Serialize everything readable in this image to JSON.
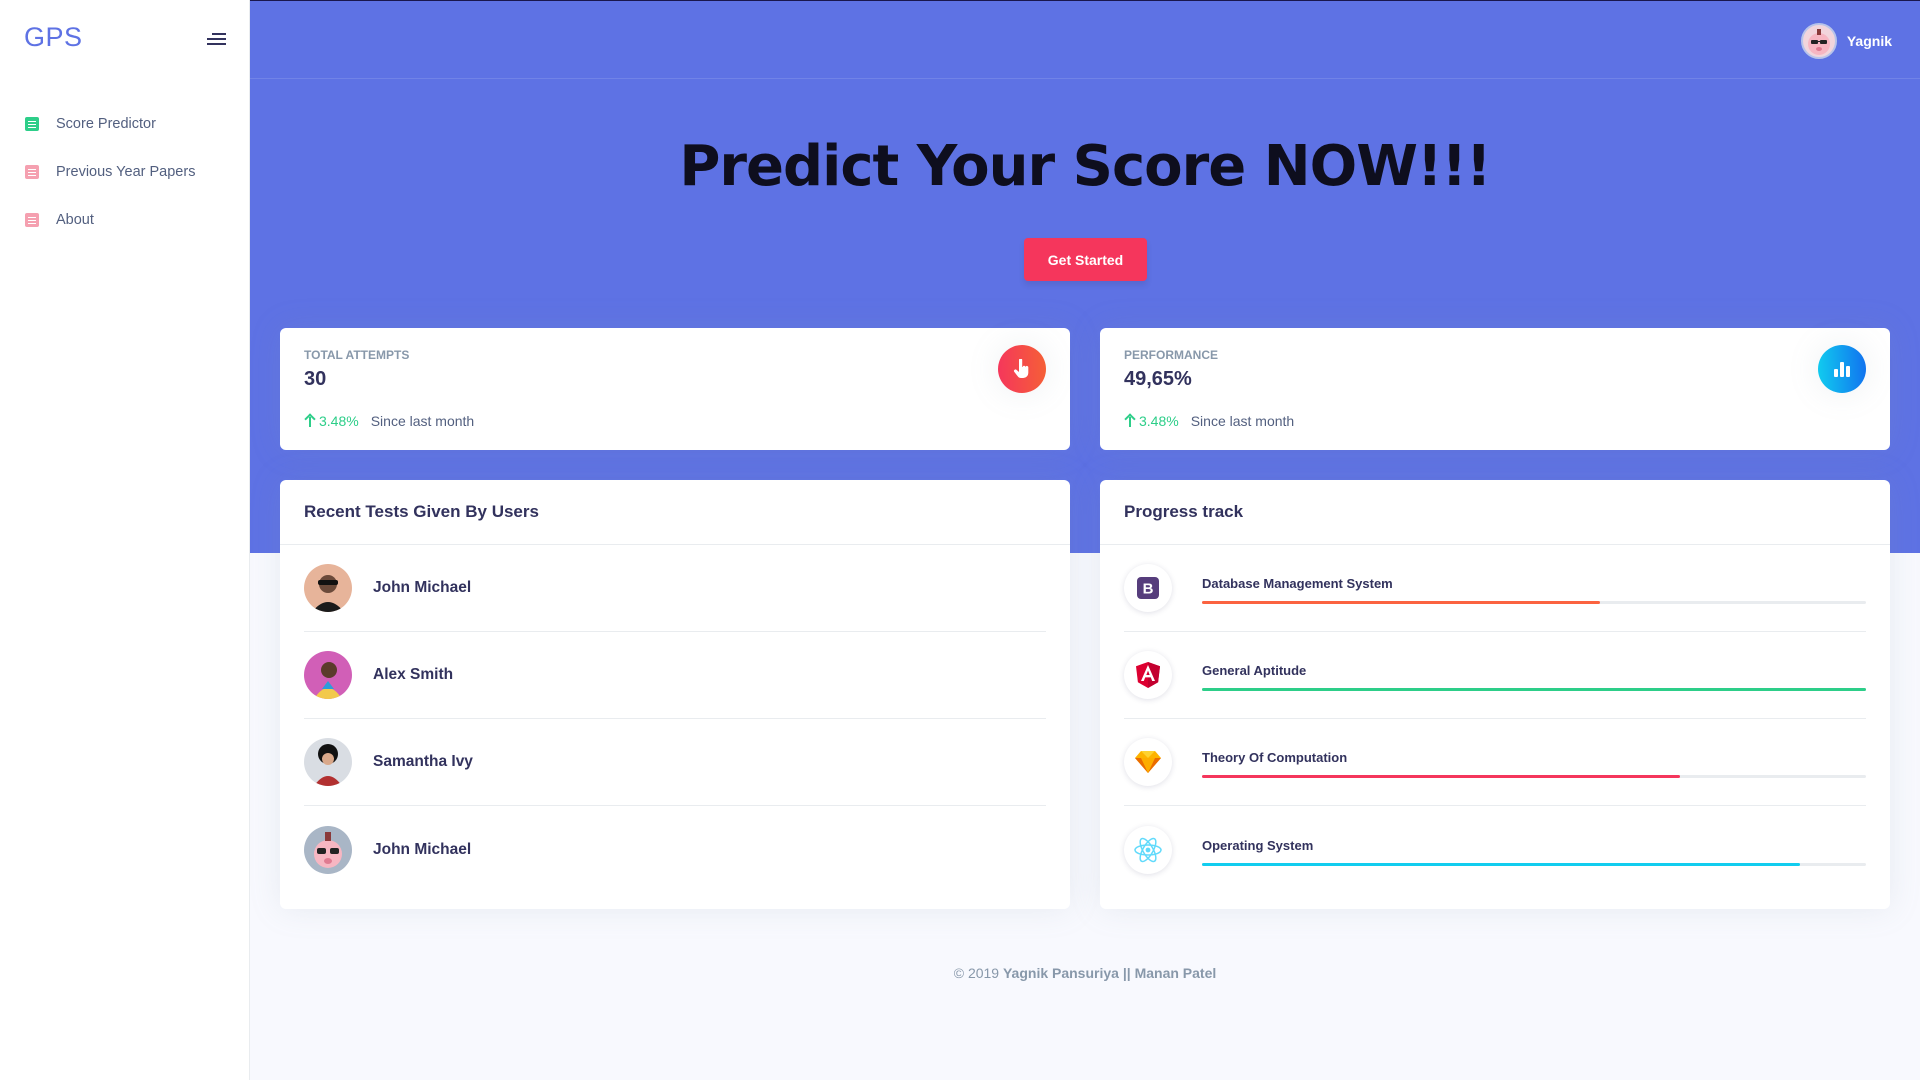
{
  "sidebar": {
    "brand": "GPS",
    "items": [
      {
        "label": "Score Predictor",
        "icon": "clipboard-icon",
        "color": "#2dce89"
      },
      {
        "label": "Previous Year Papers",
        "icon": "document-icon",
        "color": "#f5365c"
      },
      {
        "label": "About",
        "icon": "document-icon",
        "color": "#f5365c"
      }
    ]
  },
  "header": {
    "user_name": "Yagnik",
    "title_regular": "Predict Your Score ",
    "title_bold": "NOW!!!",
    "cta_label": "Get Started"
  },
  "stats": [
    {
      "label": "Total attempts",
      "value": "30",
      "change": "3.48%",
      "since": "Since last month",
      "icon": "hand-pointer-icon"
    },
    {
      "label": "Performance",
      "value": "49,65%",
      "change": "3.48%",
      "since": "Since last month",
      "icon": "bar-chart-icon"
    }
  ],
  "recent_tests": {
    "title": "Recent Tests Given By Users",
    "users": [
      {
        "name": "John Michael"
      },
      {
        "name": "Alex Smith"
      },
      {
        "name": "Samantha Ivy"
      },
      {
        "name": "John Michael"
      }
    ]
  },
  "progress": {
    "title": "Progress track",
    "items": [
      {
        "name": "Database Management System",
        "icon": "bootstrap-icon",
        "progress": 0.6,
        "color": "#fb6340"
      },
      {
        "name": "General Aptitude",
        "icon": "angular-icon",
        "progress": 1.0,
        "color": "#2dce89"
      },
      {
        "name": "Theory Of Computation",
        "icon": "sketch-icon",
        "progress": 0.72,
        "color": "#f5365c"
      },
      {
        "name": "Operating System",
        "icon": "react-icon",
        "progress": 0.9,
        "color": "#11cdef"
      }
    ]
  },
  "footer": {
    "copyright": "© 2019 ",
    "author1": "Yagnik Pansuriya",
    "separator": " || ",
    "author2": "Manan Patel"
  }
}
